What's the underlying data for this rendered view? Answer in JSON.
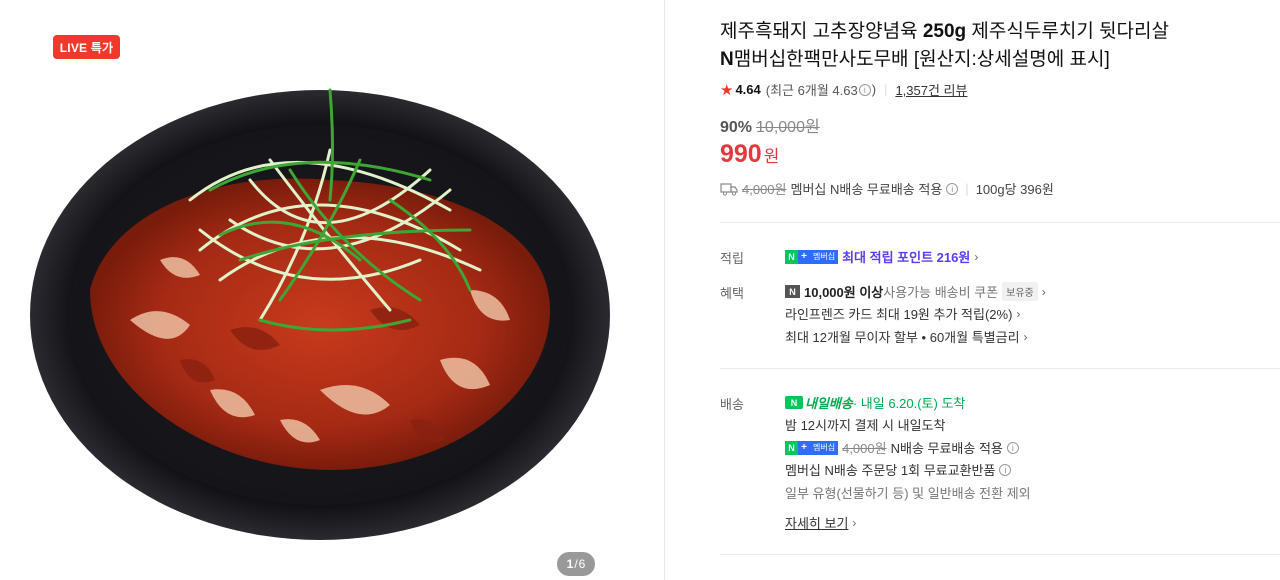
{
  "media": {
    "live_badge": "LIVE 특가",
    "pager_current": "1",
    "pager_sep": "/",
    "pager_total": "6"
  },
  "product": {
    "title_part1": "제주흑돼지 고추장양념육 ",
    "title_bold1": "250g",
    "title_part2": " 제주식두루치기 뒷다리살 ",
    "title_bold2": "N",
    "title_part3": "맴버십한팩만사도무배 [원산지:상세설명에 표시]"
  },
  "rating": {
    "score": "4.64",
    "recent": "(최근 6개월 4.63",
    "recent_close": ")",
    "reviews": "1,357건 리뷰"
  },
  "price": {
    "discount_pct": "90%",
    "original": "10,000원",
    "sale": "990",
    "currency": "원"
  },
  "shipping": {
    "old_fee": "4,000원",
    "text": "멤버십 N배송 무료배송 적용",
    "unit_price": "100g당 396원"
  },
  "benefits": {
    "points_label": "적립",
    "points_text": "최대 적립 포인트 216원",
    "benefit_label": "혜택",
    "coupon_bold": "10,000원 이상",
    "coupon_text": " 사용가능 배송비 쿠폰",
    "coupon_tag": "보유중",
    "card_text": "라인프렌즈 카드 최대 19원 추가 적립(2%)",
    "installment_text": "최대 12개월 무이자 할부 • 60개월 특별금리"
  },
  "delivery": {
    "label": "배송",
    "tomorrow_label": "내일배송",
    "tomorrow_text": " · 내일 6.20.(토) 도착",
    "deadline_text": "밤 12시까지 결제 시 내일도착",
    "member_old": "4,000원",
    "member_text": " N배송 무료배송 적용",
    "exchange_text": "멤버십 N배송 주문당 1회 무료교환반품",
    "exclude_text": "일부 유형(선물하기 등) 및 일반배송 전환 제외",
    "more_link": "자세히 보기"
  },
  "badges": {
    "n": "N",
    "plus": "+",
    "membership": "멤버십",
    "nbox": "N"
  },
  "colors": {
    "live_red": "#f0392b",
    "price_red": "#e03a3e",
    "naver_green": "#03c75a",
    "point_purple": "#5b3cf0"
  }
}
